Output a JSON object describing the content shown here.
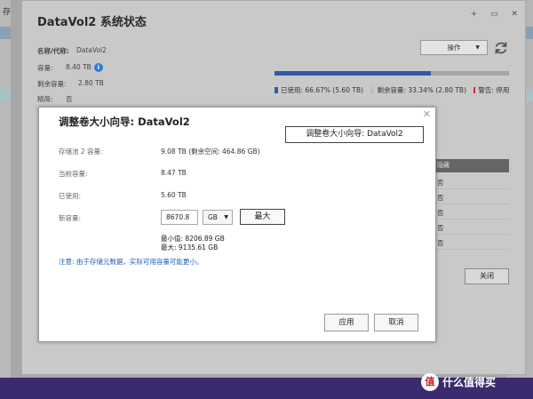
{
  "background": {
    "left_letter": "存",
    "colors": {
      "overlay": "#a7a7a7",
      "taskbar": "#3c2a70"
    }
  },
  "status_window": {
    "title": "DataVol2  系统状态",
    "controls": "+ ▭ ✕",
    "info": [
      {
        "label": "名称/代称:",
        "value": "DataVol2"
      },
      {
        "label": "容量:",
        "value": "8.40 TB"
      },
      {
        "label": "剩余容量:",
        "value": "2.80 TB"
      },
      {
        "label": "精简:",
        "value": "否"
      }
    ],
    "operations_button": "操作",
    "usage_fraction": 0.6667,
    "legend": [
      {
        "label": "已使用: 66.67% (5.60 TB)",
        "color": "#2e5caa"
      },
      {
        "label": "剩余容量: 33.34% (2.80 TB)",
        "color": "#bdbdbd"
      },
      {
        "label": "警告: 停用",
        "color": "#d9262d"
      }
    ],
    "table_header": "隐藏",
    "table_rows": [
      "否",
      "否",
      "否",
      "否",
      "否"
    ],
    "close_button": "关闭"
  },
  "dialog": {
    "title": "调整卷大小向导:  DataVol2",
    "tooltip": "调整卷大小向导:  DataVol2",
    "rows": [
      {
        "label": "存储池 2 容量:",
        "value": "9.08 TB (剩余空间:  464.86 GB)"
      },
      {
        "label": "当前容量:",
        "value": "8.47 TB"
      },
      {
        "label": "已使用:",
        "value": "5.60 TB"
      }
    ],
    "new_capacity_label": "新容量:",
    "new_capacity_value": "8670.8",
    "unit": "GB",
    "max_button": "最大",
    "min_value": "最小值:   8206.89 GB",
    "max_value": "最大:     9135.61 GB",
    "note": "注意: 由于存储元数据，实际可用容量可能更小。",
    "apply_button": "应用",
    "cancel_button": "取消"
  },
  "watermark": {
    "logo": "值",
    "text": "什么值得买"
  }
}
